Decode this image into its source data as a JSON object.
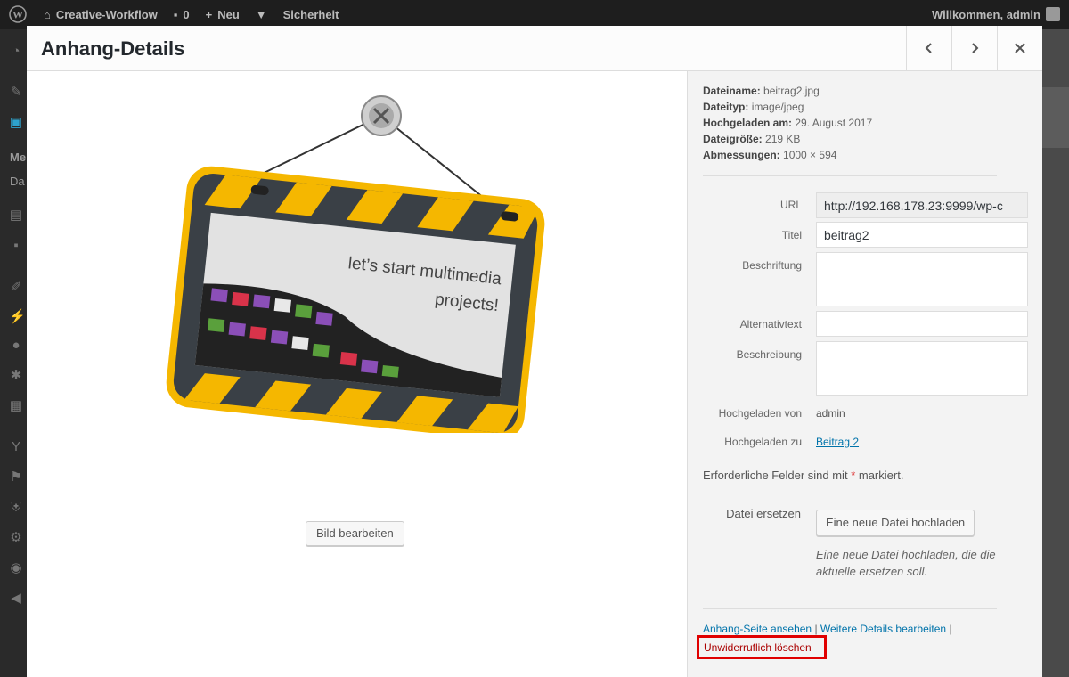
{
  "adminbar": {
    "site_name": "Creative-Workflow",
    "comments_count": "0",
    "new_label": "Neu",
    "security_label": "Sicherheit",
    "greeting": "Willkommen, admin"
  },
  "sidebar": {
    "partial_labels": [
      "Me",
      "Da"
    ]
  },
  "modal": {
    "title": "Anhang-Details",
    "prev_icon": "chevron-left-icon",
    "next_icon": "chevron-right-icon",
    "close_icon": "close-icon"
  },
  "image": {
    "slogan_line1": "let’s start multimedia",
    "slogan_line2": "projects!",
    "colors": {
      "stripe_yellow": "#f5b700",
      "board_dark": "#3a4046"
    }
  },
  "edit_image_label": "Bild bearbeiten",
  "details": {
    "filename_label": "Dateiname:",
    "filename": "beitrag2.jpg",
    "filetype_label": "Dateityp:",
    "filetype": "image/jpeg",
    "uploaded_label": "Hochgeladen am:",
    "uploaded": "29. August 2017",
    "filesize_label": "Dateigröße:",
    "filesize": "219 KB",
    "dimensions_label": "Abmessungen:",
    "dimensions": "1000 × 594"
  },
  "form": {
    "url_label": "URL",
    "url_value": "http://192.168.178.23:9999/wp-c",
    "title_label": "Titel",
    "title_value": "beitrag2",
    "caption_label": "Beschriftung",
    "caption_value": "",
    "alt_label": "Alternativtext",
    "alt_value": "",
    "description_label": "Beschreibung",
    "description_value": "",
    "uploaded_by_label": "Hochgeladen von",
    "uploaded_by": "admin",
    "uploaded_to_label": "Hochgeladen zu",
    "uploaded_to": "Beitrag 2",
    "required_note_pre": "Erforderliche Felder sind mit",
    "required_star": "*",
    "required_note_post": "markiert.",
    "replace_label": "Datei ersetzen",
    "replace_button": "Eine neue Datei hochladen",
    "replace_help": "Eine neue Datei hochladen, die die aktuelle ersetzen soll."
  },
  "actions": {
    "view_page": "Anhang-Seite ansehen",
    "separator": "|",
    "edit_more": "Weitere Details bearbeiten",
    "delete": "Unwiderruflich löschen"
  }
}
